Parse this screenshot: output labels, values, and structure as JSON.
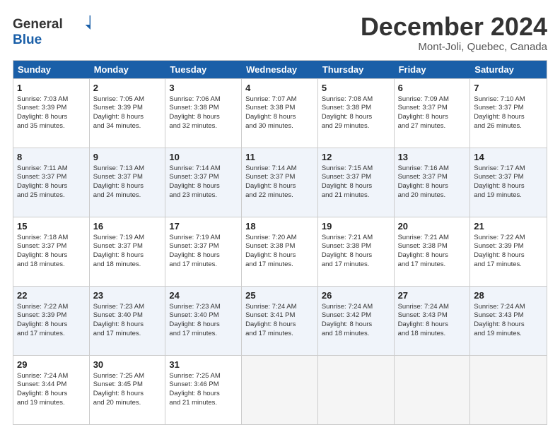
{
  "logo": {
    "line1": "General",
    "line2": "Blue"
  },
  "title": "December 2024",
  "subtitle": "Mont-Joli, Quebec, Canada",
  "days": [
    "Sunday",
    "Monday",
    "Tuesday",
    "Wednesday",
    "Thursday",
    "Friday",
    "Saturday"
  ],
  "weeks": [
    [
      {
        "day": 1,
        "sunrise": "7:03 AM",
        "sunset": "3:39 PM",
        "daylight": "8 hours and 35 minutes."
      },
      {
        "day": 2,
        "sunrise": "7:05 AM",
        "sunset": "3:39 PM",
        "daylight": "8 hours and 34 minutes."
      },
      {
        "day": 3,
        "sunrise": "7:06 AM",
        "sunset": "3:38 PM",
        "daylight": "8 hours and 32 minutes."
      },
      {
        "day": 4,
        "sunrise": "7:07 AM",
        "sunset": "3:38 PM",
        "daylight": "8 hours and 30 minutes."
      },
      {
        "day": 5,
        "sunrise": "7:08 AM",
        "sunset": "3:38 PM",
        "daylight": "8 hours and 29 minutes."
      },
      {
        "day": 6,
        "sunrise": "7:09 AM",
        "sunset": "3:37 PM",
        "daylight": "8 hours and 27 minutes."
      },
      {
        "day": 7,
        "sunrise": "7:10 AM",
        "sunset": "3:37 PM",
        "daylight": "8 hours and 26 minutes."
      }
    ],
    [
      {
        "day": 8,
        "sunrise": "7:11 AM",
        "sunset": "3:37 PM",
        "daylight": "8 hours and 25 minutes."
      },
      {
        "day": 9,
        "sunrise": "7:13 AM",
        "sunset": "3:37 PM",
        "daylight": "8 hours and 24 minutes."
      },
      {
        "day": 10,
        "sunrise": "7:14 AM",
        "sunset": "3:37 PM",
        "daylight": "8 hours and 23 minutes."
      },
      {
        "day": 11,
        "sunrise": "7:14 AM",
        "sunset": "3:37 PM",
        "daylight": "8 hours and 22 minutes."
      },
      {
        "day": 12,
        "sunrise": "7:15 AM",
        "sunset": "3:37 PM",
        "daylight": "8 hours and 21 minutes."
      },
      {
        "day": 13,
        "sunrise": "7:16 AM",
        "sunset": "3:37 PM",
        "daylight": "8 hours and 20 minutes."
      },
      {
        "day": 14,
        "sunrise": "7:17 AM",
        "sunset": "3:37 PM",
        "daylight": "8 hours and 19 minutes."
      }
    ],
    [
      {
        "day": 15,
        "sunrise": "7:18 AM",
        "sunset": "3:37 PM",
        "daylight": "8 hours and 18 minutes."
      },
      {
        "day": 16,
        "sunrise": "7:19 AM",
        "sunset": "3:37 PM",
        "daylight": "8 hours and 18 minutes."
      },
      {
        "day": 17,
        "sunrise": "7:19 AM",
        "sunset": "3:37 PM",
        "daylight": "8 hours and 17 minutes."
      },
      {
        "day": 18,
        "sunrise": "7:20 AM",
        "sunset": "3:38 PM",
        "daylight": "8 hours and 17 minutes."
      },
      {
        "day": 19,
        "sunrise": "7:21 AM",
        "sunset": "3:38 PM",
        "daylight": "8 hours and 17 minutes."
      },
      {
        "day": 20,
        "sunrise": "7:21 AM",
        "sunset": "3:38 PM",
        "daylight": "8 hours and 17 minutes."
      },
      {
        "day": 21,
        "sunrise": "7:22 AM",
        "sunset": "3:39 PM",
        "daylight": "8 hours and 17 minutes."
      }
    ],
    [
      {
        "day": 22,
        "sunrise": "7:22 AM",
        "sunset": "3:39 PM",
        "daylight": "8 hours and 17 minutes."
      },
      {
        "day": 23,
        "sunrise": "7:23 AM",
        "sunset": "3:40 PM",
        "daylight": "8 hours and 17 minutes."
      },
      {
        "day": 24,
        "sunrise": "7:23 AM",
        "sunset": "3:40 PM",
        "daylight": "8 hours and 17 minutes."
      },
      {
        "day": 25,
        "sunrise": "7:24 AM",
        "sunset": "3:41 PM",
        "daylight": "8 hours and 17 minutes."
      },
      {
        "day": 26,
        "sunrise": "7:24 AM",
        "sunset": "3:42 PM",
        "daylight": "8 hours and 18 minutes."
      },
      {
        "day": 27,
        "sunrise": "7:24 AM",
        "sunset": "3:43 PM",
        "daylight": "8 hours and 18 minutes."
      },
      {
        "day": 28,
        "sunrise": "7:24 AM",
        "sunset": "3:43 PM",
        "daylight": "8 hours and 19 minutes."
      }
    ],
    [
      {
        "day": 29,
        "sunrise": "7:24 AM",
        "sunset": "3:44 PM",
        "daylight": "8 hours and 19 minutes."
      },
      {
        "day": 30,
        "sunrise": "7:25 AM",
        "sunset": "3:45 PM",
        "daylight": "8 hours and 20 minutes."
      },
      {
        "day": 31,
        "sunrise": "7:25 AM",
        "sunset": "3:46 PM",
        "daylight": "8 hours and 21 minutes."
      },
      null,
      null,
      null,
      null
    ]
  ]
}
